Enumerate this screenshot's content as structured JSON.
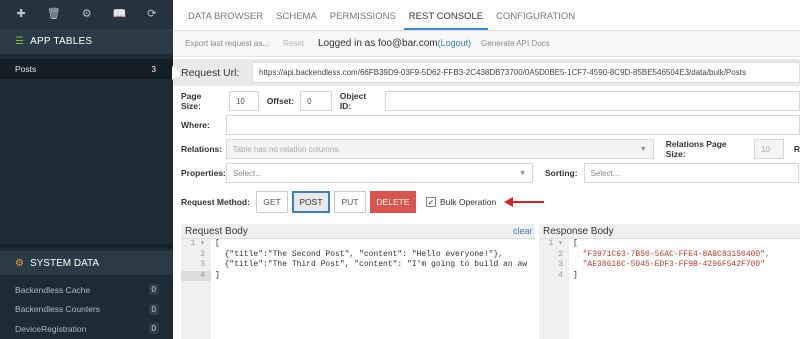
{
  "sidebar": {
    "icons": [
      "plus-icon",
      "trash-icon",
      "gear-icon",
      "book-icon",
      "refresh-icon"
    ],
    "app_tables_title": "APP TABLES",
    "tables": [
      {
        "label": "Posts",
        "count": "3"
      }
    ],
    "system_title": "SYSTEM DATA",
    "system_items": [
      {
        "label": "Backendless Cache",
        "count": "0"
      },
      {
        "label": "Backendless Counters",
        "count": "0"
      },
      {
        "label": "DeviceRegistration",
        "count": "0"
      }
    ]
  },
  "tabs": [
    "DATA BROWSER",
    "SCHEMA",
    "PERMISSIONS",
    "REST CONSOLE",
    "CONFIGURATION"
  ],
  "toolbar": {
    "export": "Export last request as...",
    "reset": "Reset",
    "logged_in": "Logged in as foo@bar.com",
    "logout": "(Logout)",
    "gen_docs": "Generate API Docs"
  },
  "request": {
    "url_label": "Request Url:",
    "url": "https://api.backendless.com/66FB39D9-03F9-5D62-FFB3-2C438DB73700/0A5D0BE5-1CF7-4590-8C9D-85BE546504E3/data/bulk/Posts",
    "page_size_label": "Page Size:",
    "page_size": "10",
    "offset_label": "Offset:",
    "offset": "0",
    "object_id_label": "Object ID:",
    "where_label": "Where:",
    "relations_label": "Relations:",
    "relations_placeholder": "Table has no relation columns.",
    "relations_page_size_label": "Relations Page Size:",
    "relations_page_size": "10",
    "relations_r": "R",
    "properties_label": "Properties:",
    "properties_placeholder": "Select...",
    "sorting_label": "Sorting:",
    "sorting_placeholder": "Select...",
    "method_label": "Request Method:",
    "methods": [
      "GET",
      "POST",
      "PUT",
      "DELETE"
    ],
    "bulk_label": "Bulk Operation",
    "bulk_check": "✓"
  },
  "request_body": {
    "title": "Request Body",
    "clear": "clear",
    "line_numbers": [
      "1",
      "2",
      "3",
      "4"
    ],
    "fold": "▾",
    "lines": [
      "[",
      "  {\"title\":\"The Second Post\", \"content\": \"Hello everyone!\"},",
      "  {\"title\":\"The Third Post\", \"content\": \"I'm going to build an aw",
      "]"
    ]
  },
  "response_body": {
    "title": "Response Body",
    "line_numbers": [
      "1",
      "2",
      "3",
      "4"
    ],
    "fold": "▾",
    "lines": [
      "[",
      "  \"F3971C63-7B50-56AC-FFE4-8ABC83150400\",",
      "  \"AE38616C-5045-EDF3-FF9B-4296F542F700\"",
      "]"
    ]
  }
}
